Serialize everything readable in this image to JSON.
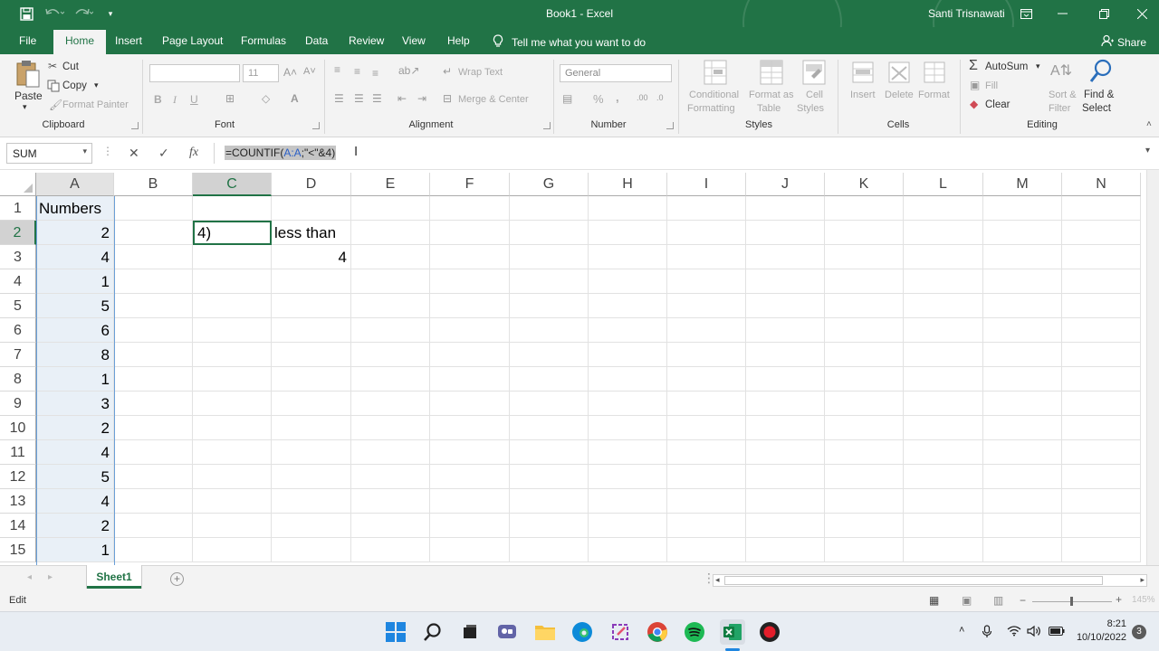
{
  "app": {
    "title": "Book1  -  Excel",
    "user": "Santi Trisnawati",
    "colors": {
      "brand": "#217346",
      "selection": "#e9f0f7"
    }
  },
  "qat": {
    "save_icon": "save-icon",
    "undo_icon": "undo-icon",
    "redo_icon": "redo-icon",
    "customize_icon": "chevron-down-icon"
  },
  "menu": {
    "tabs": [
      "File",
      "Home",
      "Insert",
      "Page Layout",
      "Formulas",
      "Data",
      "Review",
      "View",
      "Help"
    ],
    "active_tab": "Home",
    "tell_me": "Tell me what you want to do",
    "share": "Share"
  },
  "ribbon": {
    "clipboard": {
      "paste": "Paste",
      "cut": "Cut",
      "copy": "Copy",
      "format_painter": "Format Painter",
      "label": "Clipboard"
    },
    "font": {
      "font_name": "",
      "font_size": "11",
      "bold": "B",
      "italic": "I",
      "underline": "U",
      "label": "Font"
    },
    "alignment": {
      "wrap_text": "Wrap Text",
      "merge_center": "Merge & Center",
      "label": "Alignment"
    },
    "number": {
      "format": "General",
      "percent": "%",
      "comma": ",",
      "label": "Number"
    },
    "styles": {
      "conditional_1": "Conditional",
      "conditional_2": "Formatting",
      "format_table_1": "Format as",
      "format_table_2": "Table",
      "cell_styles_1": "Cell",
      "cell_styles_2": "Styles",
      "label": "Styles"
    },
    "cells": {
      "insert": "Insert",
      "delete": "Delete",
      "format": "Format",
      "label": "Cells"
    },
    "editing": {
      "autosum": "AutoSum",
      "fill": "Fill",
      "clear": "Clear",
      "sort_1": "Sort &",
      "sort_2": "Filter",
      "find_1": "Find &",
      "find_2": "Select",
      "label": "Editing"
    }
  },
  "formula_bar": {
    "name_box": "SUM",
    "cancel": "✕",
    "enter": "✓",
    "fx": "fx",
    "formula_prefix": "=COUNTIF(",
    "formula_ref": "A:A",
    "formula_suffix": ";\"<\"&4)"
  },
  "grid": {
    "columns": [
      "A",
      "B",
      "C",
      "D",
      "E",
      "F",
      "G",
      "H",
      "I",
      "J",
      "K",
      "L",
      "M",
      "N"
    ],
    "rows": [
      "1",
      "2",
      "3",
      "4",
      "5",
      "6",
      "7",
      "8",
      "9",
      "10",
      "11",
      "12",
      "13",
      "14",
      "15"
    ],
    "A1": "Numbers",
    "column_a_values": [
      "2",
      "4",
      "1",
      "5",
      "6",
      "8",
      "1",
      "3",
      "2",
      "4",
      "5",
      "4",
      "2",
      "1"
    ],
    "C2": "4)",
    "D2": "less than",
    "D3": "4"
  },
  "sheets": {
    "tabs": [
      "Sheet1"
    ],
    "active": "Sheet1",
    "add": "+"
  },
  "status": {
    "mode": "Edit",
    "zoom": "145%"
  },
  "taskbar": {
    "time": "8:21",
    "date": "10/10/2022",
    "notifications": "3"
  }
}
